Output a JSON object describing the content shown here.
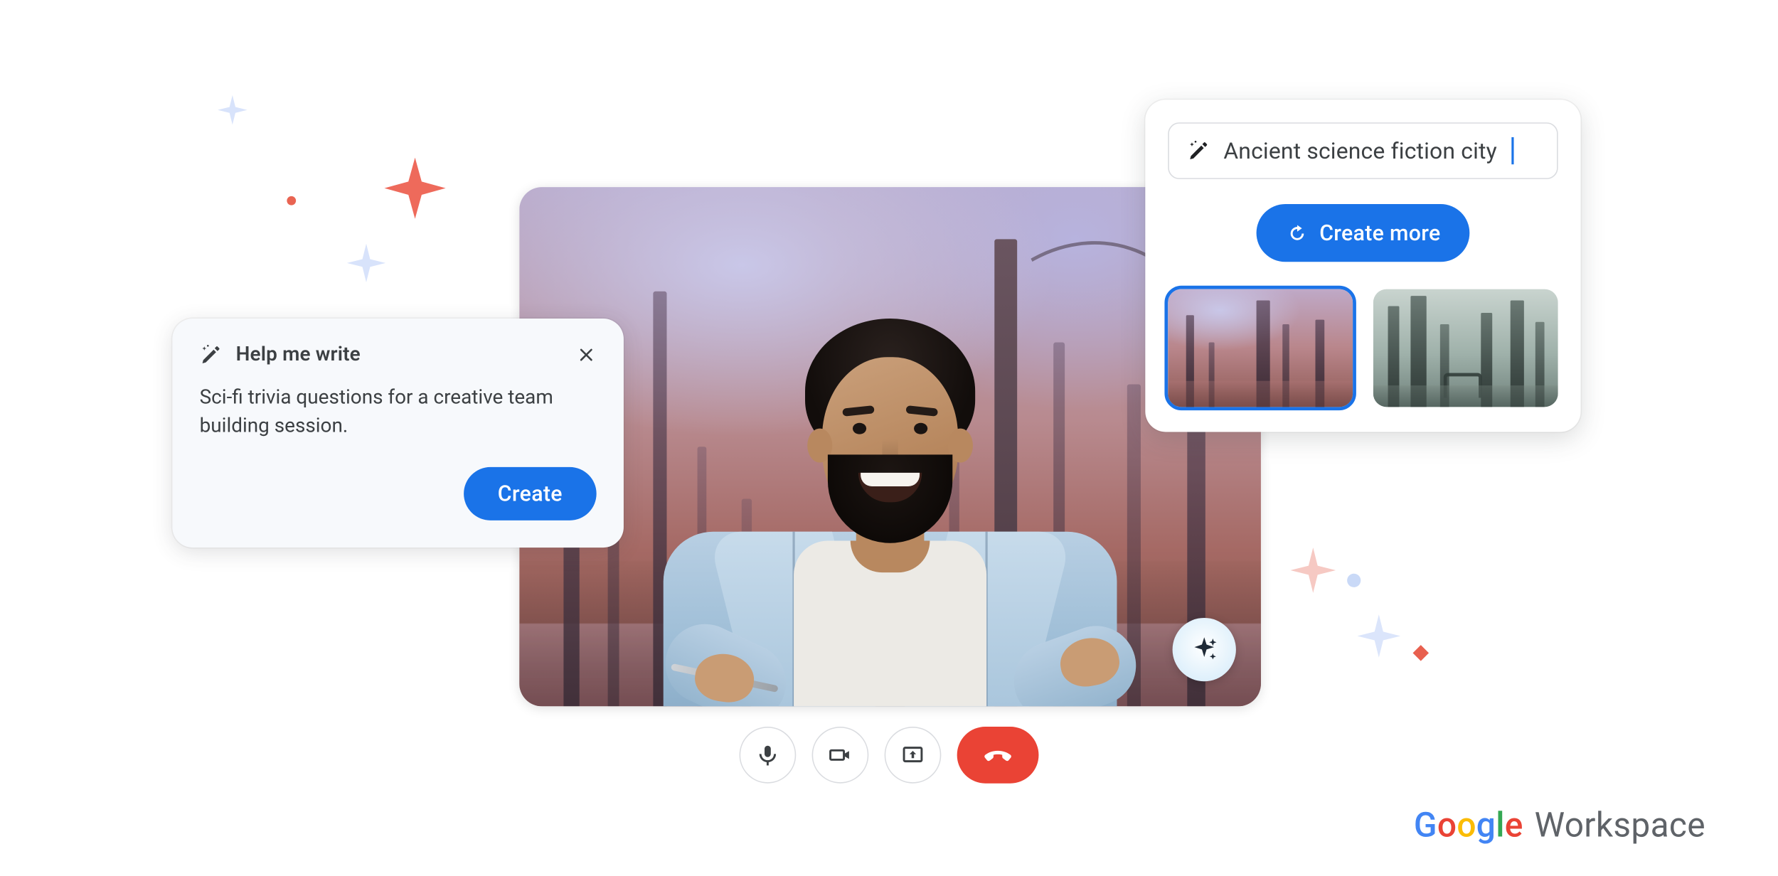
{
  "writeCard": {
    "title": "Help me write",
    "body": "Sci-fi trivia questions for a creative team building session.",
    "cta": "Create"
  },
  "genCard": {
    "prompt": "Ancient science fiction city",
    "cta": "Create more",
    "thumbs": [
      {
        "name": "background-option-1",
        "selected": true
      },
      {
        "name": "background-option-2",
        "selected": false
      }
    ]
  },
  "controls": {
    "mic": "microphone",
    "cam": "camera",
    "present": "present-screen",
    "end": "end-call"
  },
  "brand": {
    "google": "Google",
    "workspace": "Workspace"
  },
  "colors": {
    "primary": "#1a73e8",
    "danger": "#ea4335",
    "text": "#3c4043",
    "border": "#dadce0"
  }
}
